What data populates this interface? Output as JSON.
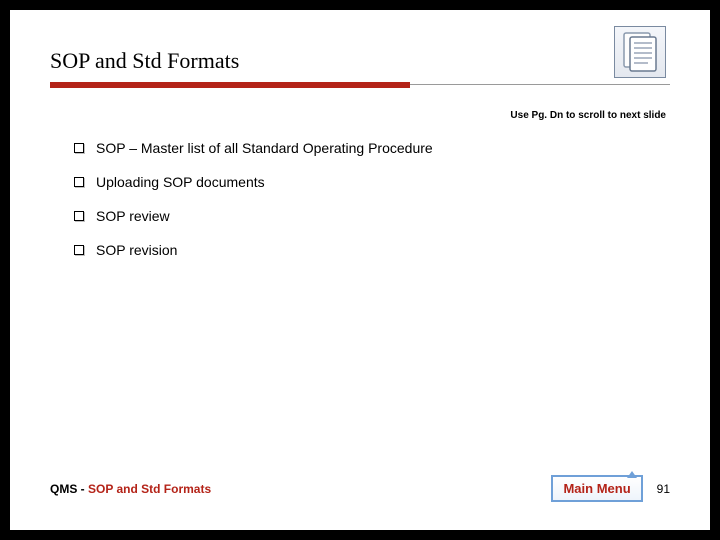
{
  "title": "SOP and Std Formats",
  "hint": "Use Pg. Dn to scroll to next slide",
  "bullets": [
    "SOP – Master list of all Standard Operating Procedure",
    "Uploading SOP documents",
    "SOP review",
    "SOP revision"
  ],
  "footer": {
    "prefix": "QMS",
    "separator": " - ",
    "section": "SOP and Std Formats",
    "main_menu_label": "Main Menu",
    "page_number": "91"
  }
}
